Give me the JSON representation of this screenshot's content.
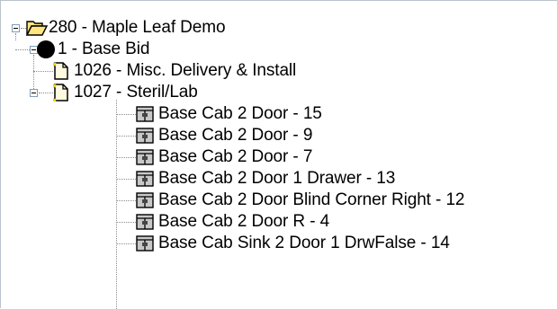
{
  "tree": {
    "root": {
      "label": "280 - Maple Leaf Demo",
      "expanded": true,
      "icon": "open-folder-icon",
      "children": [
        {
          "label": "1 - Base Bid",
          "expanded": true,
          "icon": "black-circle-icon",
          "children": [
            {
              "label": "1026 - Misc. Delivery & Install",
              "icon": "document-icon"
            },
            {
              "label": "1027 - Steril/Lab",
              "expanded": true,
              "icon": "document-icon",
              "children": [
                {
                  "label": "Base Cab 2 Door - 15",
                  "icon": "cabinet-icon"
                },
                {
                  "label": "Base Cab 2 Door - 9",
                  "icon": "cabinet-icon"
                },
                {
                  "label": "Base Cab 2 Door  - 7",
                  "icon": "cabinet-icon"
                },
                {
                  "label": "Base Cab 2 Door 1 Drawer - 13",
                  "icon": "cabinet-icon"
                },
                {
                  "label": "Base Cab 2 Door Blind Corner Right - 12",
                  "icon": "cabinet-icon"
                },
                {
                  "label": "Base Cab 2 Door R - 4",
                  "icon": "cabinet-icon"
                },
                {
                  "label": "Base Cab Sink 2 Door 1 DrwFalse - 14",
                  "icon": "cabinet-icon"
                }
              ]
            }
          ]
        }
      ]
    }
  }
}
